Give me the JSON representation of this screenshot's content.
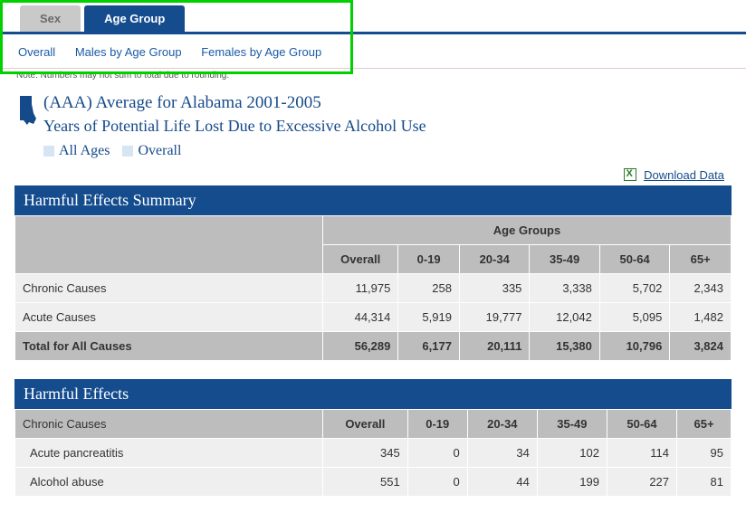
{
  "tabs": {
    "sex": "Sex",
    "age_group": "Age Group"
  },
  "subnav": {
    "overall": "Overall",
    "males": "Males by Age Group",
    "females": "Females by Age Group"
  },
  "note": "Note: Numbers may not sum to total due to rounding.",
  "title": {
    "line1": "(AAA) Average for Alabama 2001-2005",
    "line2": "Years of Potential Life Lost Due to Excessive Alcohol Use"
  },
  "filters": {
    "ages": "All Ages",
    "overall": "Overall"
  },
  "download": "Download Data",
  "columns": [
    "Overall",
    "0-19",
    "20-34",
    "35-49",
    "50-64",
    "65+"
  ],
  "summary_section": "Harmful Effects Summary",
  "summary_group_header": "Age Groups",
  "summary_rows": [
    {
      "label": "Chronic Causes",
      "vals": [
        "11,975",
        "258",
        "335",
        "3,338",
        "5,702",
        "2,343"
      ]
    },
    {
      "label": "Acute Causes",
      "vals": [
        "44,314",
        "5,919",
        "19,777",
        "12,042",
        "5,095",
        "1,482"
      ]
    }
  ],
  "summary_total": {
    "label": "Total for All Causes",
    "vals": [
      "56,289",
      "6,177",
      "20,111",
      "15,380",
      "10,796",
      "3,824"
    ]
  },
  "effects_section": "Harmful Effects",
  "effects_subheader": "Chronic Causes",
  "effects_rows": [
    {
      "label": "Acute pancreatitis",
      "vals": [
        "345",
        "0",
        "34",
        "102",
        "114",
        "95"
      ]
    },
    {
      "label": "Alcohol abuse",
      "vals": [
        "551",
        "0",
        "44",
        "199",
        "227",
        "81"
      ]
    }
  ],
  "chart_data": {
    "type": "table",
    "title": "Years of Potential Life Lost Due to Excessive Alcohol Use — Alabama 2001-2005",
    "categories": [
      "Overall",
      "0-19",
      "20-34",
      "35-49",
      "50-64",
      "65+"
    ],
    "series": [
      {
        "name": "Chronic Causes",
        "values": [
          11975,
          258,
          335,
          3338,
          5702,
          2343
        ]
      },
      {
        "name": "Acute Causes",
        "values": [
          44314,
          5919,
          19777,
          12042,
          5095,
          1482
        ]
      },
      {
        "name": "Total for All Causes",
        "values": [
          56289,
          6177,
          20111,
          15380,
          10796,
          3824
        ]
      },
      {
        "name": "Acute pancreatitis",
        "values": [
          345,
          0,
          34,
          102,
          114,
          95
        ]
      },
      {
        "name": "Alcohol abuse",
        "values": [
          551,
          0,
          44,
          199,
          227,
          81
        ]
      }
    ]
  }
}
